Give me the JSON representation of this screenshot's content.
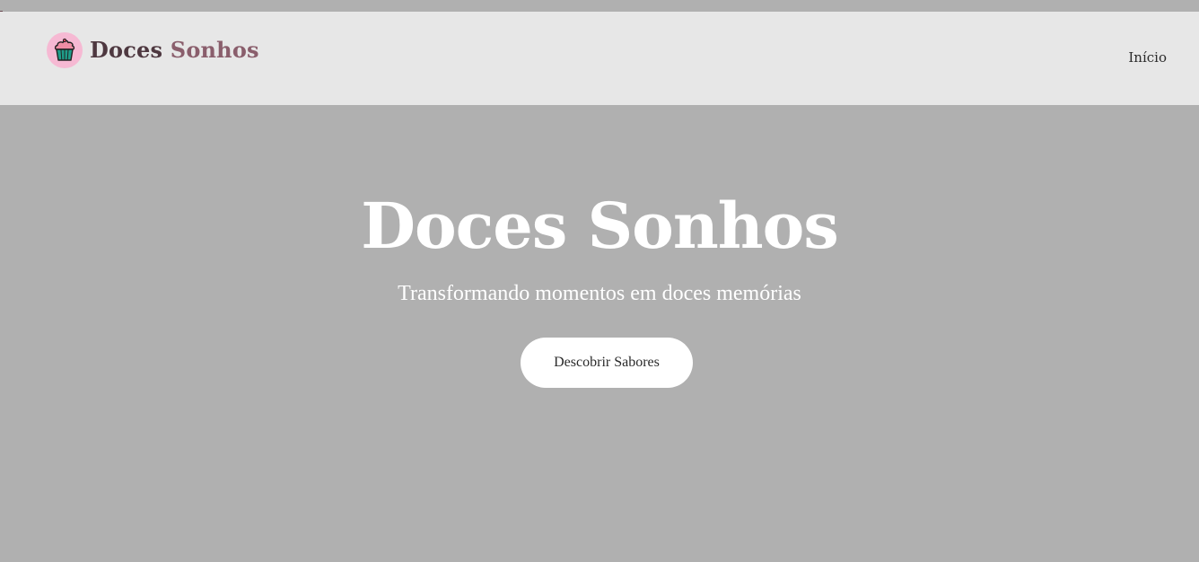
{
  "header": {
    "brand_icon": "cupcake-icon",
    "brand_first": "Doces",
    "brand_second": "Sonhos",
    "nav_items": [
      {
        "label": "Início"
      }
    ]
  },
  "hero": {
    "title": "Doces Sonhos",
    "subtitle": "Transformando momentos em doces memórias",
    "cta_label": "Descobrir Sabores"
  },
  "colors": {
    "page_background": "#b0b0b0",
    "navbar_background": "#e7e7e7",
    "logo_circle": "#f6b9d3",
    "brand_dark": "#4e3840",
    "brand_light": "#8a5e6c",
    "hero_text": "#ffffff",
    "button_background": "#ffffff"
  }
}
